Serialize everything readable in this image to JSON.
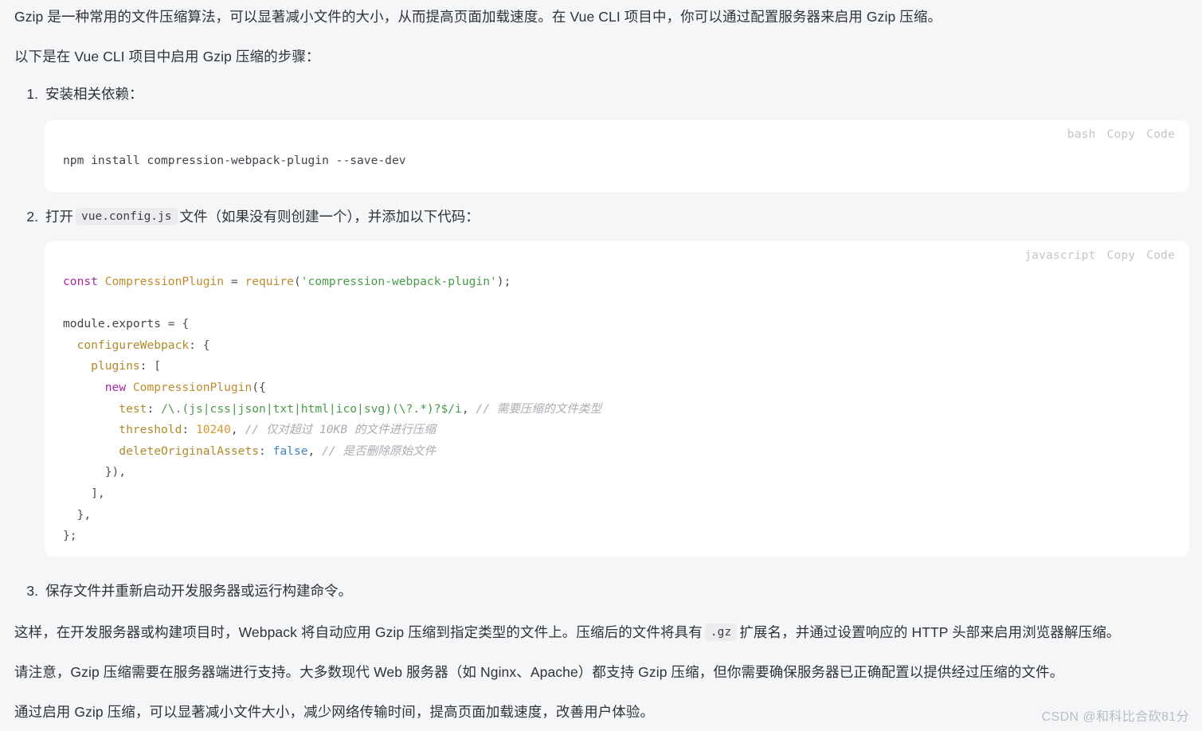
{
  "page": {
    "background_color": "#f5f6f7",
    "text_color": "#2f3337"
  },
  "intro": {
    "paragraph": "Gzip 是一种常用的文件压缩算法，可以显著减小文件的大小，从而提高页面加载速度。在 Vue CLI 项目中，你可以通过配置服务器来启用 Gzip 压缩。",
    "steps_lead": "以下是在 Vue CLI 项目中启用 Gzip 压缩的步骤："
  },
  "steps": [
    {
      "number": "1.",
      "text": "安装相关依赖："
    },
    {
      "number": "2.",
      "text_before": "打开",
      "inline_code": "vue.config.js",
      "text_after": "文件（如果没有则创建一个），并添加以下代码："
    },
    {
      "number": "3.",
      "text": "保存文件并重新启动开发服务器或运行构建命令。"
    }
  ],
  "code_blocks": [
    {
      "language_label": "bash",
      "copy_label": "Copy",
      "code_label": "Code",
      "code": "npm install compression-webpack-plugin --save-dev",
      "lines": [
        [
          {
            "t": "npm install compression-webpack-plugin --save-dev",
            "c": "tok-plain"
          }
        ]
      ]
    },
    {
      "language_label": "javascript",
      "copy_label": "Copy",
      "code_label": "Code",
      "lines": [
        [
          {
            "t": "const ",
            "c": "tok-kw"
          },
          {
            "t": "CompressionPlugin ",
            "c": "tok-cls"
          },
          {
            "t": "= ",
            "c": "tok-punct"
          },
          {
            "t": "require",
            "c": "tok-fn"
          },
          {
            "t": "(",
            "c": "tok-punct"
          },
          {
            "t": "'compression-webpack-plugin'",
            "c": "tok-str"
          },
          {
            "t": ");",
            "c": "tok-punct"
          }
        ],
        [],
        [
          {
            "t": "module",
            "c": "tok-plain"
          },
          {
            "t": ".exports ",
            "c": "tok-plain"
          },
          {
            "t": "= {",
            "c": "tok-punct"
          }
        ],
        [
          {
            "t": "  ",
            "c": "tok-plain"
          },
          {
            "t": "configureWebpack",
            "c": "tok-key"
          },
          {
            "t": ": {",
            "c": "tok-punct"
          }
        ],
        [
          {
            "t": "    ",
            "c": "tok-plain"
          },
          {
            "t": "plugins",
            "c": "tok-key"
          },
          {
            "t": ": [",
            "c": "tok-punct"
          }
        ],
        [
          {
            "t": "      ",
            "c": "tok-plain"
          },
          {
            "t": "new ",
            "c": "tok-kw"
          },
          {
            "t": "CompressionPlugin",
            "c": "tok-cls"
          },
          {
            "t": "({",
            "c": "tok-punct"
          }
        ],
        [
          {
            "t": "        ",
            "c": "tok-plain"
          },
          {
            "t": "test",
            "c": "tok-key"
          },
          {
            "t": ": ",
            "c": "tok-punct"
          },
          {
            "t": "/\\.(js|css|json|txt|html|ico|svg)(\\?.*)?$/i",
            "c": "tok-regex"
          },
          {
            "t": ", ",
            "c": "tok-punct"
          },
          {
            "t": "// 需要压缩的文件类型",
            "c": "tok-comment"
          }
        ],
        [
          {
            "t": "        ",
            "c": "tok-plain"
          },
          {
            "t": "threshold",
            "c": "tok-key"
          },
          {
            "t": ": ",
            "c": "tok-punct"
          },
          {
            "t": "10240",
            "c": "tok-num"
          },
          {
            "t": ", ",
            "c": "tok-punct"
          },
          {
            "t": "// 仅对超过 10KB 的文件进行压缩",
            "c": "tok-comment"
          }
        ],
        [
          {
            "t": "        ",
            "c": "tok-plain"
          },
          {
            "t": "deleteOriginalAssets",
            "c": "tok-key"
          },
          {
            "t": ": ",
            "c": "tok-punct"
          },
          {
            "t": "false",
            "c": "tok-bool"
          },
          {
            "t": ", ",
            "c": "tok-punct"
          },
          {
            "t": "// 是否删除原始文件",
            "c": "tok-comment"
          }
        ],
        [
          {
            "t": "      }),",
            "c": "tok-punct"
          }
        ],
        [
          {
            "t": "    ],",
            "c": "tok-punct"
          }
        ],
        [
          {
            "t": "  },",
            "c": "tok-punct"
          }
        ],
        [
          {
            "t": "};",
            "c": "tok-punct"
          }
        ]
      ]
    }
  ],
  "closing": {
    "p1_before": "这样，在开发服务器或构建项目时，Webpack 将自动应用 Gzip 压缩到指定类型的文件上。压缩后的文件将具有",
    "p1_code": ".gz",
    "p1_after": "扩展名，并通过设置响应的 HTTP 头部来启用浏览器解压缩。",
    "p2": "请注意，Gzip 压缩需要在服务器端进行支持。大多数现代 Web 服务器（如 Nginx、Apache）都支持 Gzip 压缩，但你需要确保服务器已正确配置以提供经过压缩的文件。",
    "p3": "通过启用 Gzip 压缩，可以显著减小文件大小，减少网络传输时间，提高页面加载速度，改善用户体验。"
  },
  "watermark": {
    "text": "CSDN @和科比合砍81分"
  }
}
